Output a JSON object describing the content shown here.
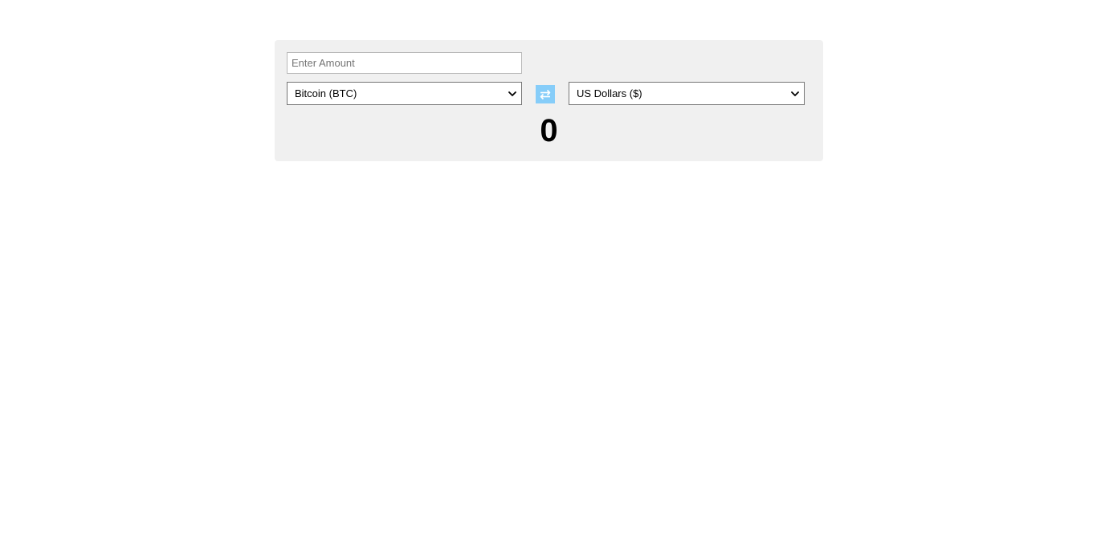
{
  "converter": {
    "amount_input": {
      "value": "",
      "placeholder": "Enter Amount"
    },
    "from_currency": {
      "selected": "Bitcoin (BTC)"
    },
    "to_currency": {
      "selected": "US Dollars ($)"
    },
    "swap_button": {
      "icon": "swap-arrows-icon"
    },
    "result": "0"
  },
  "colors": {
    "panel_background": "#f0f0f0",
    "swap_button_background": "#86cdf9",
    "swap_icon": "#ffffff"
  }
}
